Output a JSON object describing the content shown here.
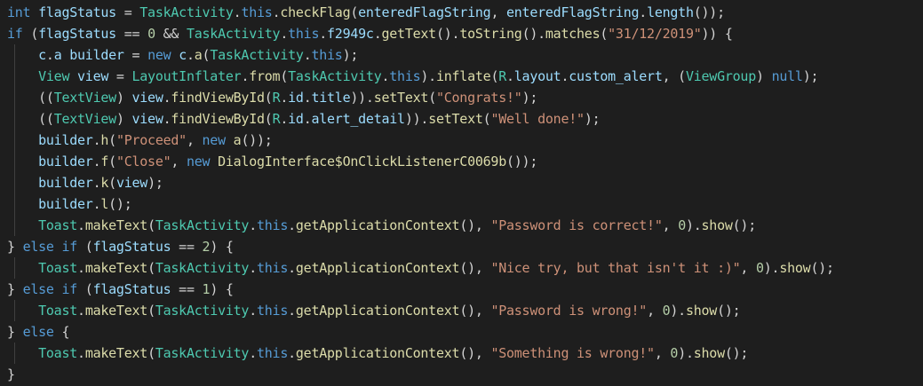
{
  "colors": {
    "background": "#1e1e1e",
    "keyword": "#569cd6",
    "type": "#4ec9b0",
    "variable": "#9cdcfe",
    "function": "#dcdcaa",
    "string": "#ce9178",
    "number": "#b5cea8",
    "plain": "#d4d4d4"
  },
  "code": {
    "lines": [
      {
        "indent": false,
        "tokens": [
          [
            "kw",
            "int"
          ],
          [
            "pl",
            " "
          ],
          [
            "var",
            "flagStatus"
          ],
          [
            "pl",
            " = "
          ],
          [
            "ty",
            "TaskActivity"
          ],
          [
            "pl",
            "."
          ],
          [
            "kw",
            "this"
          ],
          [
            "pl",
            "."
          ],
          [
            "fn",
            "checkFlag"
          ],
          [
            "pl",
            "("
          ],
          [
            "var",
            "enteredFlagString"
          ],
          [
            "pl",
            ", "
          ],
          [
            "var",
            "enteredFlagString"
          ],
          [
            "pl",
            "."
          ],
          [
            "var",
            "length"
          ],
          [
            "pl",
            "());"
          ]
        ]
      },
      {
        "indent": false,
        "tokens": [
          [
            "kw",
            "if"
          ],
          [
            "pl",
            " ("
          ],
          [
            "var",
            "flagStatus"
          ],
          [
            "pl",
            " == "
          ],
          [
            "num",
            "0"
          ],
          [
            "pl",
            " && "
          ],
          [
            "ty",
            "TaskActivity"
          ],
          [
            "pl",
            "."
          ],
          [
            "kw",
            "this"
          ],
          [
            "pl",
            "."
          ],
          [
            "var",
            "f2949c"
          ],
          [
            "pl",
            "."
          ],
          [
            "fn",
            "getText"
          ],
          [
            "pl",
            "()."
          ],
          [
            "fn",
            "toString"
          ],
          [
            "pl",
            "()."
          ],
          [
            "fn",
            "matches"
          ],
          [
            "pl",
            "("
          ],
          [
            "str",
            "\"31/12/2019\""
          ],
          [
            "pl",
            ")) {"
          ]
        ]
      },
      {
        "indent": true,
        "tokens": [
          [
            "pl",
            "    "
          ],
          [
            "var",
            "c"
          ],
          [
            "pl",
            "."
          ],
          [
            "var",
            "a"
          ],
          [
            "pl",
            " "
          ],
          [
            "var",
            "builder"
          ],
          [
            "pl",
            " = "
          ],
          [
            "kw",
            "new"
          ],
          [
            "pl",
            " "
          ],
          [
            "var",
            "c"
          ],
          [
            "pl",
            "."
          ],
          [
            "fn",
            "a"
          ],
          [
            "pl",
            "("
          ],
          [
            "ty",
            "TaskActivity"
          ],
          [
            "pl",
            "."
          ],
          [
            "kw",
            "this"
          ],
          [
            "pl",
            ");"
          ]
        ]
      },
      {
        "indent": true,
        "tokens": [
          [
            "pl",
            "    "
          ],
          [
            "ty",
            "View"
          ],
          [
            "pl",
            " "
          ],
          [
            "var",
            "view"
          ],
          [
            "pl",
            " = "
          ],
          [
            "ty",
            "LayoutInflater"
          ],
          [
            "pl",
            "."
          ],
          [
            "fn",
            "from"
          ],
          [
            "pl",
            "("
          ],
          [
            "ty",
            "TaskActivity"
          ],
          [
            "pl",
            "."
          ],
          [
            "kw",
            "this"
          ],
          [
            "pl",
            ")."
          ],
          [
            "fn",
            "inflate"
          ],
          [
            "pl",
            "("
          ],
          [
            "ty",
            "R"
          ],
          [
            "pl",
            "."
          ],
          [
            "var",
            "layout"
          ],
          [
            "pl",
            "."
          ],
          [
            "var",
            "custom_alert"
          ],
          [
            "pl",
            ", ("
          ],
          [
            "ty",
            "ViewGroup"
          ],
          [
            "pl",
            ") "
          ],
          [
            "kw",
            "null"
          ],
          [
            "pl",
            ");"
          ]
        ]
      },
      {
        "indent": true,
        "tokens": [
          [
            "pl",
            "    (("
          ],
          [
            "ty",
            "TextView"
          ],
          [
            "pl",
            ") "
          ],
          [
            "var",
            "view"
          ],
          [
            "pl",
            "."
          ],
          [
            "fn",
            "findViewById"
          ],
          [
            "pl",
            "("
          ],
          [
            "ty",
            "R"
          ],
          [
            "pl",
            "."
          ],
          [
            "var",
            "id"
          ],
          [
            "pl",
            "."
          ],
          [
            "var",
            "title"
          ],
          [
            "pl",
            "))."
          ],
          [
            "fn",
            "setText"
          ],
          [
            "pl",
            "("
          ],
          [
            "str",
            "\"Congrats!\""
          ],
          [
            "pl",
            ");"
          ]
        ]
      },
      {
        "indent": true,
        "tokens": [
          [
            "pl",
            "    (("
          ],
          [
            "ty",
            "TextView"
          ],
          [
            "pl",
            ") "
          ],
          [
            "var",
            "view"
          ],
          [
            "pl",
            "."
          ],
          [
            "fn",
            "findViewById"
          ],
          [
            "pl",
            "("
          ],
          [
            "ty",
            "R"
          ],
          [
            "pl",
            "."
          ],
          [
            "var",
            "id"
          ],
          [
            "pl",
            "."
          ],
          [
            "var",
            "alert_detail"
          ],
          [
            "pl",
            "))."
          ],
          [
            "fn",
            "setText"
          ],
          [
            "pl",
            "("
          ],
          [
            "str",
            "\"Well done!\""
          ],
          [
            "pl",
            ");"
          ]
        ]
      },
      {
        "indent": true,
        "tokens": [
          [
            "pl",
            "    "
          ],
          [
            "var",
            "builder"
          ],
          [
            "pl",
            "."
          ],
          [
            "fn",
            "h"
          ],
          [
            "pl",
            "("
          ],
          [
            "str",
            "\"Proceed\""
          ],
          [
            "pl",
            ", "
          ],
          [
            "kw",
            "new"
          ],
          [
            "pl",
            " "
          ],
          [
            "fn",
            "a"
          ],
          [
            "pl",
            "());"
          ]
        ]
      },
      {
        "indent": true,
        "tokens": [
          [
            "pl",
            "    "
          ],
          [
            "var",
            "builder"
          ],
          [
            "pl",
            "."
          ],
          [
            "fn",
            "f"
          ],
          [
            "pl",
            "("
          ],
          [
            "str",
            "\"Close\""
          ],
          [
            "pl",
            ", "
          ],
          [
            "kw",
            "new"
          ],
          [
            "pl",
            " "
          ],
          [
            "fn",
            "DialogInterface$OnClickListenerC0069b"
          ],
          [
            "pl",
            "());"
          ]
        ]
      },
      {
        "indent": true,
        "tokens": [
          [
            "pl",
            "    "
          ],
          [
            "var",
            "builder"
          ],
          [
            "pl",
            "."
          ],
          [
            "fn",
            "k"
          ],
          [
            "pl",
            "("
          ],
          [
            "var",
            "view"
          ],
          [
            "pl",
            ");"
          ]
        ]
      },
      {
        "indent": true,
        "tokens": [
          [
            "pl",
            "    "
          ],
          [
            "var",
            "builder"
          ],
          [
            "pl",
            "."
          ],
          [
            "fn",
            "l"
          ],
          [
            "pl",
            "();"
          ]
        ]
      },
      {
        "indent": true,
        "tokens": [
          [
            "pl",
            "    "
          ],
          [
            "ty",
            "Toast"
          ],
          [
            "pl",
            "."
          ],
          [
            "fn",
            "makeText"
          ],
          [
            "pl",
            "("
          ],
          [
            "ty",
            "TaskActivity"
          ],
          [
            "pl",
            "."
          ],
          [
            "kw",
            "this"
          ],
          [
            "pl",
            "."
          ],
          [
            "fn",
            "getApplicationContext"
          ],
          [
            "pl",
            "(), "
          ],
          [
            "str",
            "\"Password is correct!\""
          ],
          [
            "pl",
            ", "
          ],
          [
            "num",
            "0"
          ],
          [
            "pl",
            ")."
          ],
          [
            "fn",
            "show"
          ],
          [
            "pl",
            "();"
          ]
        ]
      },
      {
        "indent": false,
        "tokens": [
          [
            "pl",
            "} "
          ],
          [
            "kw",
            "else"
          ],
          [
            "pl",
            " "
          ],
          [
            "kw",
            "if"
          ],
          [
            "pl",
            " ("
          ],
          [
            "var",
            "flagStatus"
          ],
          [
            "pl",
            " == "
          ],
          [
            "num",
            "2"
          ],
          [
            "pl",
            ") {"
          ]
        ]
      },
      {
        "indent": true,
        "tokens": [
          [
            "pl",
            "    "
          ],
          [
            "ty",
            "Toast"
          ],
          [
            "pl",
            "."
          ],
          [
            "fn",
            "makeText"
          ],
          [
            "pl",
            "("
          ],
          [
            "ty",
            "TaskActivity"
          ],
          [
            "pl",
            "."
          ],
          [
            "kw",
            "this"
          ],
          [
            "pl",
            "."
          ],
          [
            "fn",
            "getApplicationContext"
          ],
          [
            "pl",
            "(), "
          ],
          [
            "str",
            "\"Nice try, but that isn't it :)\""
          ],
          [
            "pl",
            ", "
          ],
          [
            "num",
            "0"
          ],
          [
            "pl",
            ")."
          ],
          [
            "fn",
            "show"
          ],
          [
            "pl",
            "();"
          ]
        ]
      },
      {
        "indent": false,
        "tokens": [
          [
            "pl",
            "} "
          ],
          [
            "kw",
            "else"
          ],
          [
            "pl",
            " "
          ],
          [
            "kw",
            "if"
          ],
          [
            "pl",
            " ("
          ],
          [
            "var",
            "flagStatus"
          ],
          [
            "pl",
            " == "
          ],
          [
            "num",
            "1"
          ],
          [
            "pl",
            ") {"
          ]
        ]
      },
      {
        "indent": true,
        "tokens": [
          [
            "pl",
            "    "
          ],
          [
            "ty",
            "Toast"
          ],
          [
            "pl",
            "."
          ],
          [
            "fn",
            "makeText"
          ],
          [
            "pl",
            "("
          ],
          [
            "ty",
            "TaskActivity"
          ],
          [
            "pl",
            "."
          ],
          [
            "kw",
            "this"
          ],
          [
            "pl",
            "."
          ],
          [
            "fn",
            "getApplicationContext"
          ],
          [
            "pl",
            "(), "
          ],
          [
            "str",
            "\"Password is wrong!\""
          ],
          [
            "pl",
            ", "
          ],
          [
            "num",
            "0"
          ],
          [
            "pl",
            ")."
          ],
          [
            "fn",
            "show"
          ],
          [
            "pl",
            "();"
          ]
        ]
      },
      {
        "indent": false,
        "tokens": [
          [
            "pl",
            "} "
          ],
          [
            "kw",
            "else"
          ],
          [
            "pl",
            " {"
          ]
        ]
      },
      {
        "indent": true,
        "tokens": [
          [
            "pl",
            "    "
          ],
          [
            "ty",
            "Toast"
          ],
          [
            "pl",
            "."
          ],
          [
            "fn",
            "makeText"
          ],
          [
            "pl",
            "("
          ],
          [
            "ty",
            "TaskActivity"
          ],
          [
            "pl",
            "."
          ],
          [
            "kw",
            "this"
          ],
          [
            "pl",
            "."
          ],
          [
            "fn",
            "getApplicationContext"
          ],
          [
            "pl",
            "(), "
          ],
          [
            "str",
            "\"Something is wrong!\""
          ],
          [
            "pl",
            ", "
          ],
          [
            "num",
            "0"
          ],
          [
            "pl",
            ")."
          ],
          [
            "fn",
            "show"
          ],
          [
            "pl",
            "();"
          ]
        ]
      },
      {
        "indent": false,
        "tokens": [
          [
            "pl",
            "}"
          ]
        ]
      }
    ]
  }
}
